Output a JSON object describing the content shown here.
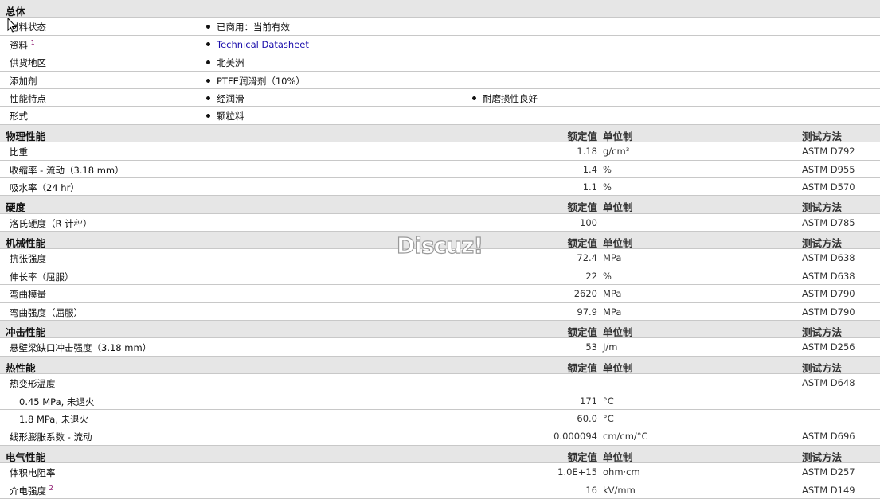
{
  "general": {
    "title": "总体",
    "rows": [
      {
        "label": "材料状态",
        "values": [
          "已商用：当前有效"
        ]
      },
      {
        "label": "资料",
        "sup": "1",
        "values": [
          "Technical Datasheet"
        ],
        "link": true
      },
      {
        "label": "供货地区",
        "values": [
          "北美洲"
        ]
      },
      {
        "label": "添加剂",
        "values": [
          "PTFE润滑剂（10%）"
        ]
      },
      {
        "label": "性能特点",
        "values": [
          "经润滑",
          "耐磨损性良好"
        ]
      },
      {
        "label": "形式",
        "values": [
          "颗粒料"
        ]
      }
    ]
  },
  "column_headers": {
    "value": "额定值",
    "unit": "单位制",
    "method": "测试方法"
  },
  "sections": [
    {
      "title": "物理性能",
      "rows": [
        {
          "label": "比重",
          "value": "1.18",
          "unit": "g/cm³",
          "method": "ASTM D792"
        },
        {
          "label": "收缩率 - 流动（3.18 mm）",
          "value": "1.4",
          "unit": "%",
          "method": "ASTM D955"
        },
        {
          "label": "吸水率（24 hr）",
          "value": "1.1",
          "unit": "%",
          "method": "ASTM D570"
        }
      ]
    },
    {
      "title": "硬度",
      "rows": [
        {
          "label": "洛氏硬度（R 计秤）",
          "value": "100",
          "unit": "",
          "method": "ASTM D785"
        }
      ]
    },
    {
      "title": "机械性能",
      "rows": [
        {
          "label": "抗张强度",
          "value": "72.4",
          "unit": "MPa",
          "method": "ASTM D638"
        },
        {
          "label": "伸长率（屈服）",
          "value": "22",
          "unit": "%",
          "method": "ASTM D638"
        },
        {
          "label": "弯曲模量",
          "value": "2620",
          "unit": "MPa",
          "method": "ASTM D790"
        },
        {
          "label": "弯曲强度（屈服）",
          "value": "97.9",
          "unit": "MPa",
          "method": "ASTM D790"
        }
      ]
    },
    {
      "title": "冲击性能",
      "rows": [
        {
          "label": "悬壁梁缺口冲击强度（3.18 mm）",
          "value": "53",
          "unit": "J/m",
          "method": "ASTM D256"
        }
      ]
    },
    {
      "title": "热性能",
      "rows": [
        {
          "label": "热变形温度",
          "value": "",
          "unit": "",
          "method": "ASTM D648"
        },
        {
          "label": "0.45 MPa, 未退火",
          "sub": true,
          "value": "171",
          "unit": "°C",
          "method": ""
        },
        {
          "label": "1.8 MPa, 未退火",
          "sub": true,
          "value": "60.0",
          "unit": "°C",
          "method": ""
        },
        {
          "label": "线形膨胀系数 - 流动",
          "value": "0.000094",
          "unit": "cm/cm/°C",
          "method": "ASTM D696"
        }
      ]
    },
    {
      "title": "电气性能",
      "rows": [
        {
          "label": "体积电阻率",
          "value": "1.0E+15",
          "unit": "ohm·cm",
          "method": "ASTM D257"
        },
        {
          "label": "介电强度",
          "sup": "2",
          "value": "16",
          "unit": "kV/mm",
          "method": "ASTM D149"
        }
      ]
    }
  ],
  "watermark": "Discuz!"
}
